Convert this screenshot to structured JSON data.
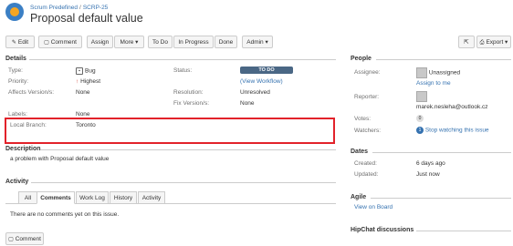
{
  "header": {
    "project": "Scrum Predefined",
    "separator": "/",
    "issue_key": "SCRP-25",
    "title": "Proposal default value"
  },
  "toolbar": {
    "edit": "Edit",
    "comment": "Comment",
    "assign": "Assign",
    "more": "More ▾",
    "todo": "To Do",
    "in_progress": "In Progress",
    "done": "Done",
    "admin": "Admin ▾",
    "export": "Export ▾"
  },
  "details": {
    "heading": "Details",
    "type_label": "Type:",
    "type_value": "Bug",
    "priority_label": "Priority:",
    "priority_value": "Highest",
    "affects_label": "Affects Version/s:",
    "affects_value": "None",
    "labels_label": "Labels:",
    "labels_value": "None",
    "branch_label": "Local Branch:",
    "branch_value": "Toronto",
    "status_label": "Status:",
    "status_value": "TO DO",
    "workflow_link": "(View Workflow)",
    "resolution_label": "Resolution:",
    "resolution_value": "Unresolved",
    "fix_label": "Fix Version/s:",
    "fix_value": "None"
  },
  "description": {
    "heading": "Description",
    "text": "a problem with Proposal default value"
  },
  "activity": {
    "heading": "Activity",
    "tabs": [
      "All",
      "Comments",
      "Work Log",
      "History",
      "Activity"
    ],
    "empty": "There are no comments yet on this issue.",
    "comment_button": "Comment"
  },
  "people": {
    "heading": "People",
    "assignee_label": "Assignee:",
    "assignee_value": "Unassigned",
    "assign_to_me": "Assign to me",
    "reporter_label": "Reporter:",
    "reporter_value": "marek.nesleha@outlook.cz",
    "votes_label": "Votes:",
    "votes_value": "0",
    "watchers_label": "Watchers:",
    "watchers_count": "1",
    "watch_link": "Stop watching this issue"
  },
  "dates": {
    "heading": "Dates",
    "created_label": "Created:",
    "created_value": "6 days ago",
    "updated_label": "Updated:",
    "updated_value": "Just now"
  },
  "agile": {
    "heading": "Agile",
    "link": "View on Board"
  },
  "hipchat": {
    "heading": "HipChat discussions"
  },
  "colors": {
    "link": "#3572b0",
    "status_bg": "#4a6785",
    "highlight": "#e2222a",
    "priority": "#d04437"
  }
}
